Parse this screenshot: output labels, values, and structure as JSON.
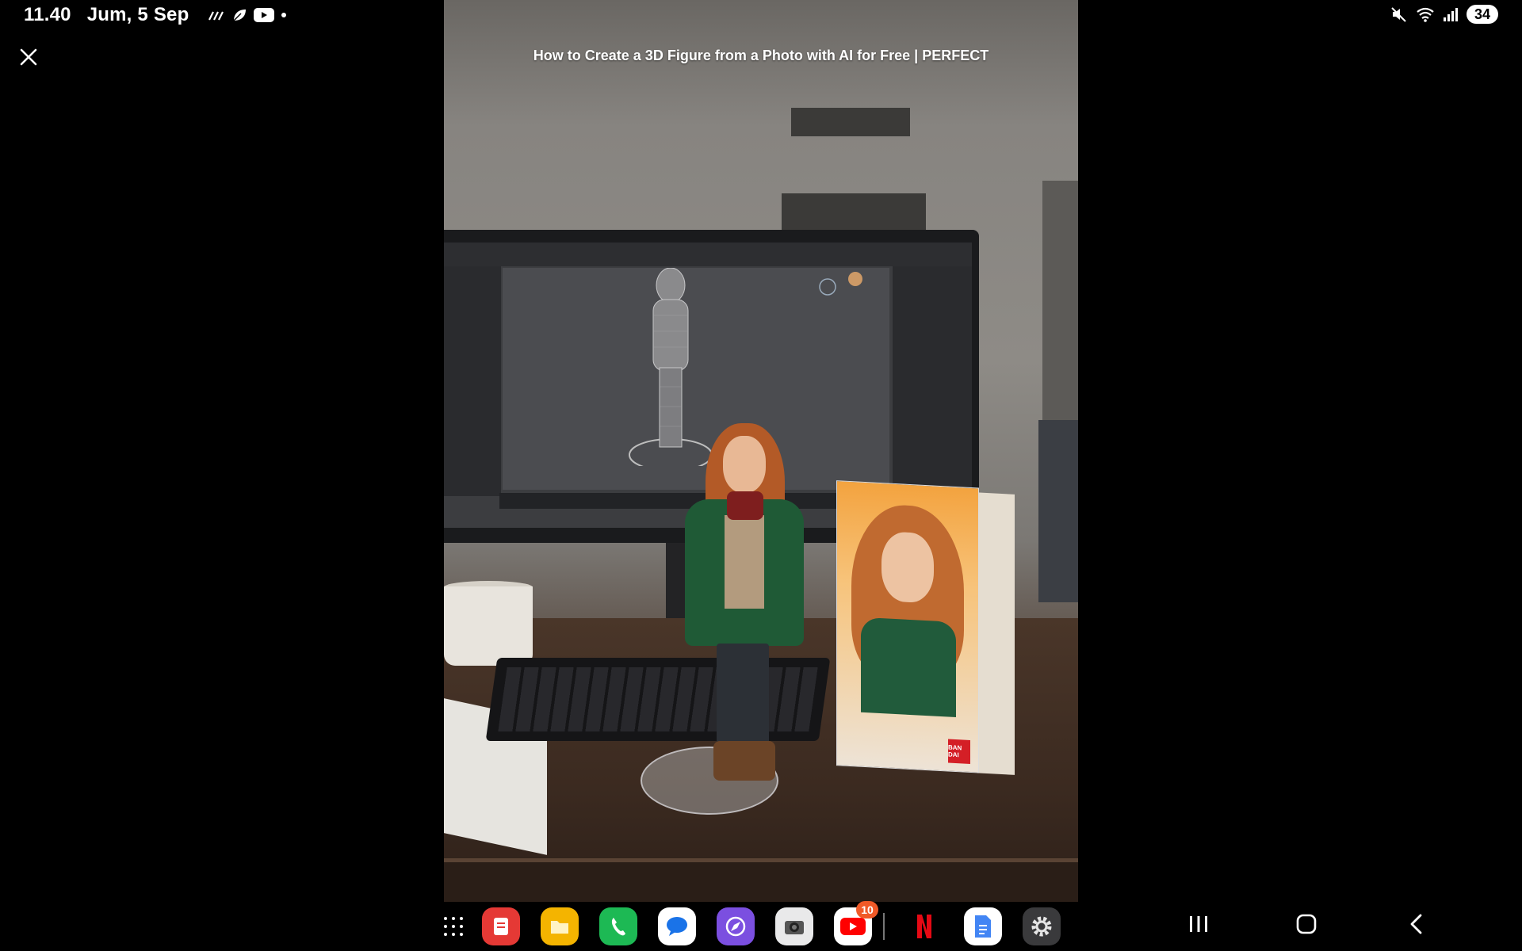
{
  "status_bar": {
    "time": "11.40",
    "date": "Jum, 5 Sep",
    "battery": "34",
    "left_icons": [
      "signal-lines-icon",
      "leaf-icon",
      "youtube-icon",
      "dot-icon"
    ],
    "right_icons": [
      "mute-icon",
      "wifi-icon",
      "cellular-signal-icon",
      "battery-icon"
    ]
  },
  "video": {
    "title": "How to Create a 3D Figure from a Photo with AI for Free | PERFECT",
    "box_logo_text": "BAN DAI"
  },
  "taskbar": {
    "apps": [
      {
        "name": "notes-app",
        "color": "#e53935"
      },
      {
        "name": "files-app",
        "color": "#f4b400"
      },
      {
        "name": "phone-app",
        "color": "#1db954"
      },
      {
        "name": "messages-app",
        "color": "#ffffff"
      },
      {
        "name": "browser-app",
        "color": "#7b4fe0"
      },
      {
        "name": "camera-app",
        "color": "#e9e9ea"
      },
      {
        "name": "youtube-app",
        "color": "#ffffff",
        "badge": "10"
      },
      {
        "name": "netflix-app",
        "color": "#000000"
      },
      {
        "name": "docs-app",
        "color": "#ffffff"
      },
      {
        "name": "settings-app",
        "color": "#3a3a3c"
      }
    ]
  },
  "colors": {
    "background": "#000000",
    "badge": "#f05a28",
    "text": "#ffffff"
  }
}
